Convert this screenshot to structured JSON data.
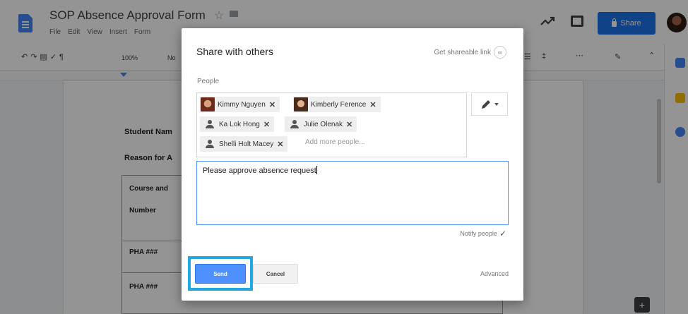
{
  "app": {
    "doc_title": "SOP Absence Approval Form",
    "menus": [
      "File",
      "Edit",
      "View",
      "Insert",
      "Form"
    ],
    "share_label": "Share"
  },
  "toolbar": {
    "zoom": "100%",
    "style": "No"
  },
  "document": {
    "student_name_label": "Student Nam",
    "reason_label": "Reason for A",
    "course_label_line1": "Course and",
    "course_label_line2": "Number",
    "rows": [
      "PHA ###",
      "PHA ###"
    ]
  },
  "dialog": {
    "title": "Share with others",
    "shareable_link": "Get shareable link",
    "people_label": "People",
    "chips": [
      {
        "name": "Kimmy Nguyen",
        "avatar": "photo"
      },
      {
        "name": "Kimberly Ference",
        "avatar": "photo"
      },
      {
        "name": "Ka Lok Hong",
        "avatar": "person-icon"
      },
      {
        "name": "Julie Olenak",
        "avatar": "person-icon"
      },
      {
        "name": "Shelli Holt Macey",
        "avatar": "person-icon"
      }
    ],
    "add_placeholder": "Add more people...",
    "message": "Please approve absence request",
    "notify_label": "Notify people",
    "notify_checked": true,
    "send_label": "Send",
    "cancel_label": "Cancel",
    "advanced_label": "Advanced"
  },
  "colors": {
    "share_blue": "#1a73e8",
    "send_blue": "#4d90fe",
    "highlight": "#22a8e0"
  }
}
